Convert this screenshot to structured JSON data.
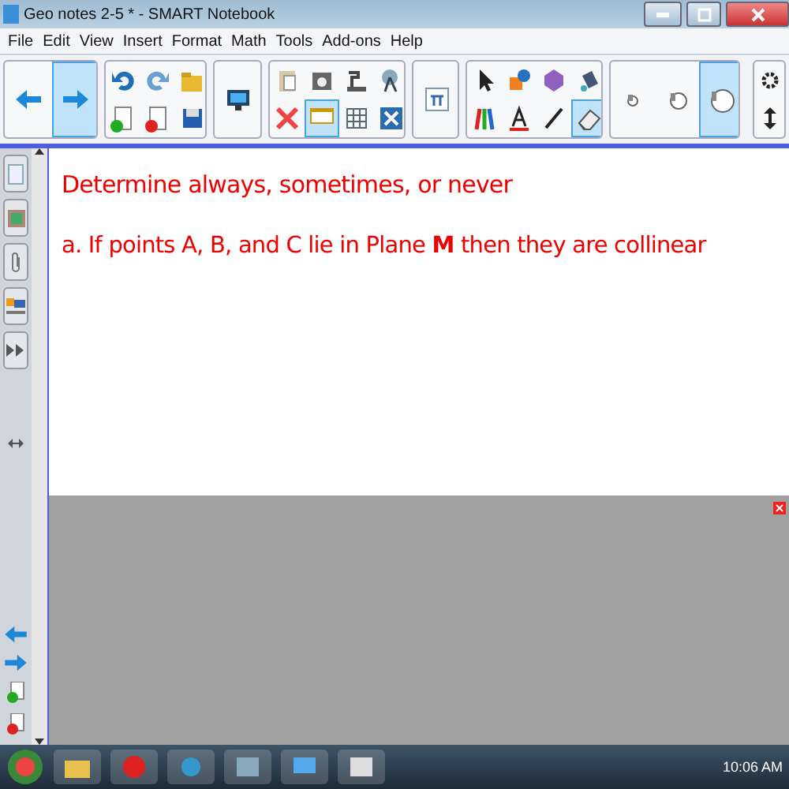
{
  "window": {
    "title": "Geo notes 2-5 * - SMART Notebook"
  },
  "menu": [
    "File",
    "Edit",
    "View",
    "Insert",
    "Format",
    "Math",
    "Tools",
    "Add-ons",
    "Help"
  ],
  "toolbar": [
    {
      "items": [
        {
          "kind": "back",
          "selected": false
        },
        {
          "kind": "forward",
          "selected": true
        }
      ]
    },
    {
      "items": [
        {
          "kind": "undo",
          "selected": false
        },
        {
          "kind": "redo",
          "selected": false
        },
        {
          "kind": "folder",
          "selected": false
        },
        {
          "kind": "page-add",
          "selected": false
        },
        {
          "kind": "page-delete",
          "selected": false
        },
        {
          "kind": "save",
          "selected": false
        }
      ]
    },
    {
      "items": [
        {
          "kind": "monitor",
          "selected": false
        }
      ]
    },
    {
      "items": [
        {
          "kind": "clipboard",
          "selected": false
        },
        {
          "kind": "camera",
          "selected": false
        },
        {
          "kind": "doc-camera",
          "selected": false
        },
        {
          "kind": "compass",
          "selected": false
        },
        {
          "kind": "delete",
          "selected": false
        },
        {
          "kind": "screen",
          "selected": true
        },
        {
          "kind": "table",
          "selected": false
        },
        {
          "kind": "toolbox",
          "selected": false
        }
      ]
    },
    {
      "items": [
        {
          "kind": "pi",
          "selected": false
        }
      ]
    },
    {
      "items": [
        {
          "kind": "pointer",
          "selected": false
        },
        {
          "kind": "shapes",
          "selected": false
        },
        {
          "kind": "hexagon",
          "selected": false
        },
        {
          "kind": "bucket",
          "selected": false
        },
        {
          "kind": "pens",
          "selected": false
        },
        {
          "kind": "text",
          "selected": false
        },
        {
          "kind": "line",
          "selected": false
        },
        {
          "kind": "eraser",
          "selected": true
        }
      ]
    },
    {
      "items": [
        {
          "kind": "eraser-small",
          "selected": false
        },
        {
          "kind": "eraser-medium",
          "selected": false
        },
        {
          "kind": "eraser-large",
          "selected": true
        }
      ]
    }
  ],
  "page": {
    "lines": [
      "Determine always, sometimes, or never",
      "a. If points A, B, and C lie in Plane **M** then they are collinear"
    ]
  },
  "taskbar": {
    "clock": "10:06 AM"
  }
}
